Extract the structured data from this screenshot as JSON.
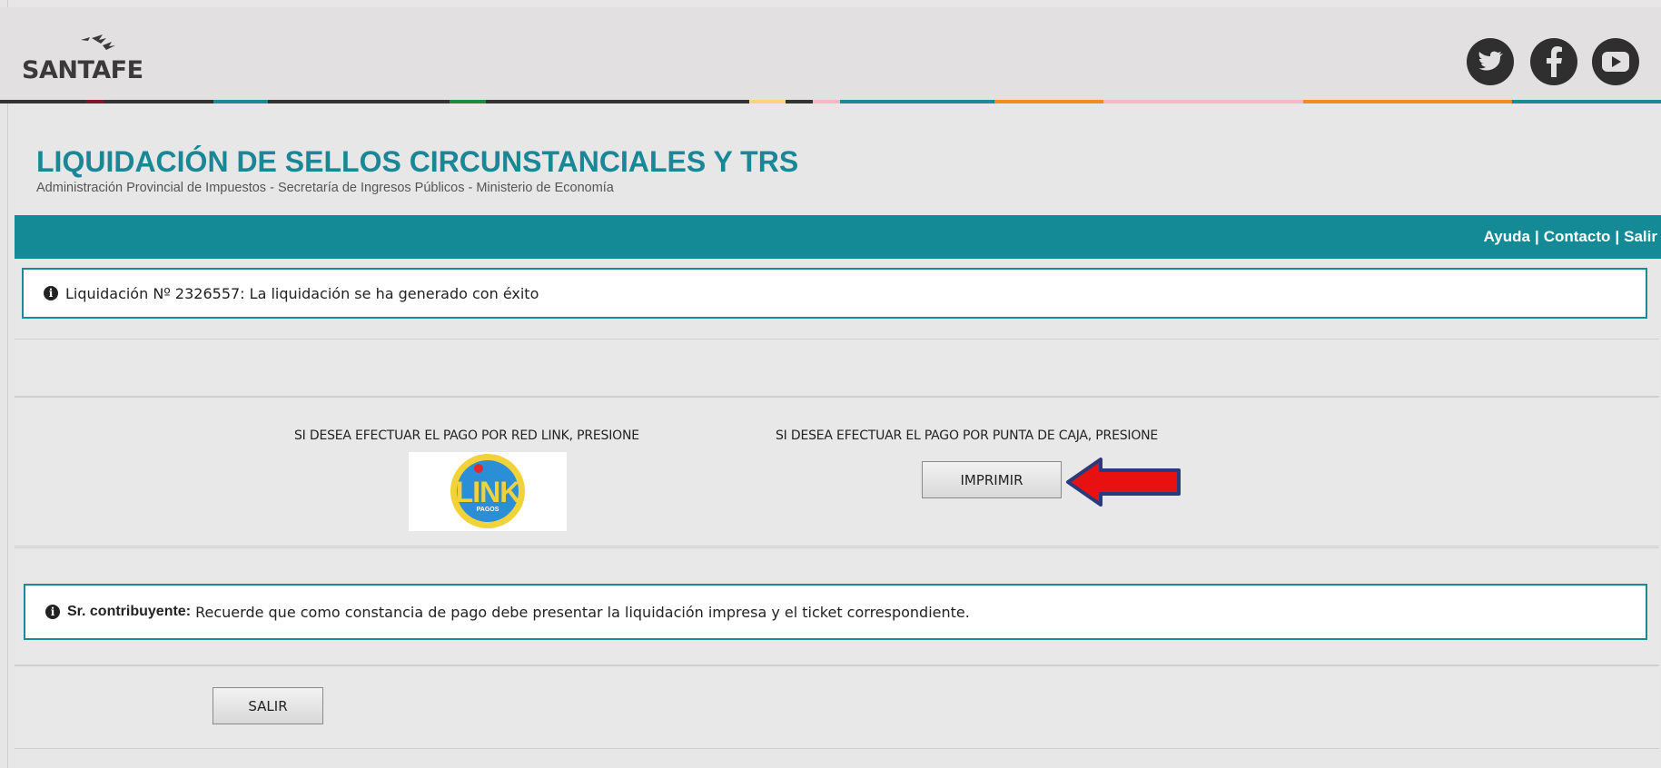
{
  "header": {
    "logo_text": "SANTAFE",
    "social_icons": [
      "twitter-icon",
      "facebook-icon",
      "youtube-icon"
    ],
    "stripe_colors": [
      "#333333",
      "#7a1a2a",
      "#333333",
      "#1c8a96",
      "#333333",
      "#1d8c3a",
      "#333333",
      "#ffd27f",
      "#333333",
      "#f7b6c6",
      "#1c8a96",
      "#f28c1e",
      "#f7b6c6",
      "#f28c1e",
      "#1c8a96"
    ]
  },
  "title": {
    "main": "LIQUIDACIÓN DE SELLOS CIRCUNSTANCIALES Y TRS",
    "subtitle": "Administración Provincial de Impuestos - Secretaría de Ingresos Públicos - Ministerio de Economía"
  },
  "nav": {
    "help": "Ayuda",
    "contact": "Contacto",
    "exit": "Salir",
    "sep": "|"
  },
  "success_alert": {
    "text": "Liquidación Nº 2326557: La liquidación se ha generado con éxito"
  },
  "payment": {
    "link_label": "SI DESEA EFECTUAR EL PAGO POR RED LINK, PRESIONE",
    "link_logo_text": "LINK",
    "link_logo_sub": "PAGOS",
    "cash_label": "SI DESEA EFECTUAR EL PAGO POR PUNTA DE CAJA, PRESIONE",
    "print_button": "IMPRIMIR"
  },
  "notice": {
    "bold": "Sr. contribuyente:",
    "text": " Recuerde que como constancia de pago debe presentar la liquidación impresa y el ticket correspondiente."
  },
  "footer": {
    "exit_button": "SALIR"
  },
  "colors": {
    "accent": "#138a96",
    "arrow": "#e81010"
  }
}
